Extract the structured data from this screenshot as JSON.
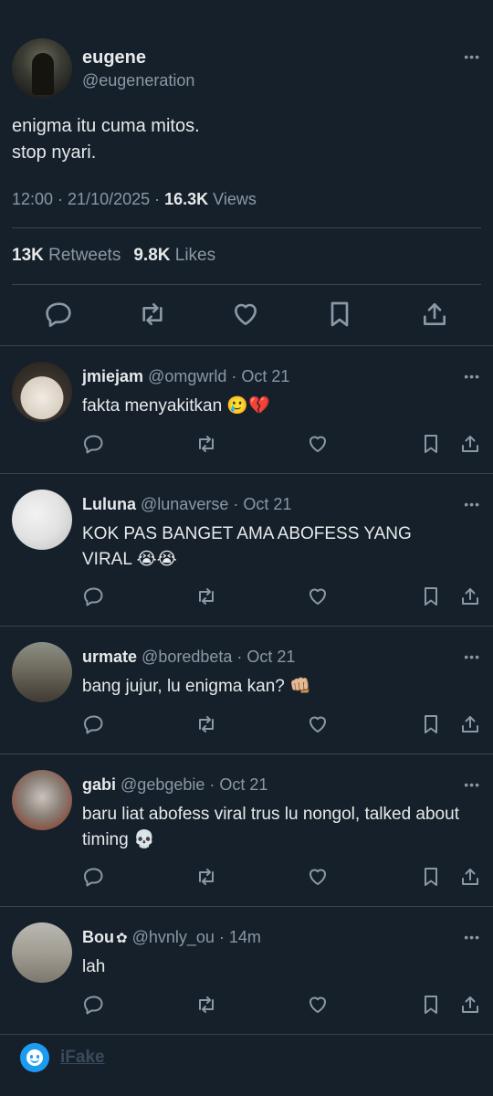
{
  "tweet": {
    "name": "eugene",
    "handle": "@eugeneration",
    "more": "•••",
    "text": "enigma itu cuma mitos.\nstop nyari.",
    "time": "12:00 · 21/10/2025 · ",
    "views_count": "16.3K",
    "views_label": " Views",
    "retweets_count": "13K",
    "retweets_label": " Retweets",
    "likes_count": "9.8K",
    "likes_label": " Likes"
  },
  "replies": [
    {
      "name": "jmiejam",
      "handle": "@omgwrld · Oct 21",
      "text": "fakta menyakitkan 🥲💔",
      "more": "•••"
    },
    {
      "name": "Luluna",
      "handle": "@lunaverse · Oct 21",
      "text": "KOK PAS BANGET AMA ABOFESS YANG VIRAL 😭😭",
      "more": "•••"
    },
    {
      "name": "urmate",
      "handle": "@boredbeta · Oct 21",
      "text": "bang jujur, lu enigma kan? 👊🏼",
      "more": "•••"
    },
    {
      "name": "gabi",
      "handle": "@gebgebie · Oct 21",
      "text": "baru liat abofess viral trus lu nongol, talked about timing 💀",
      "more": "•••"
    },
    {
      "name": "Bou",
      "badge": "✿",
      "handle": "@hvnly_ou · 14m",
      "text": "lah",
      "more": "•••"
    }
  ],
  "icons": [
    "reply-icon",
    "retweet-icon",
    "like-icon",
    "bookmark-icon",
    "share-icon"
  ],
  "footer": {
    "brand": "iFake"
  },
  "colors": {
    "background": "#15202b",
    "secondary_text": "#8b98a5",
    "divider": "#38444d",
    "accent": "#1d9bf0"
  }
}
